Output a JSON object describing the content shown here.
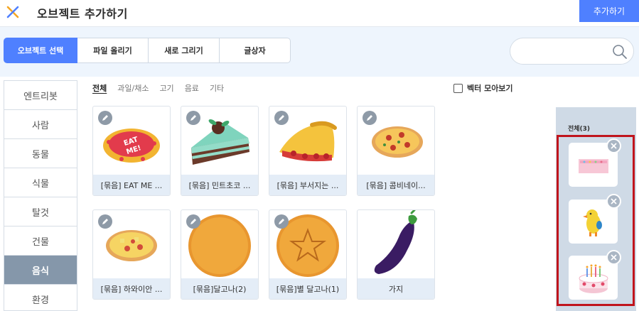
{
  "header": {
    "title": "오브젝트 추가하기",
    "add_button": "추가하기",
    "close_icon": "close-x-icon",
    "colors": {
      "accent": "#4f80ff",
      "close_x": [
        "#f5a623",
        "#4f80ff"
      ]
    }
  },
  "tabs": [
    {
      "label": "오브젝트 선택",
      "active": true
    },
    {
      "label": "파일 올리기",
      "active": false
    },
    {
      "label": "새로 그리기",
      "active": false
    },
    {
      "label": "글상자",
      "active": false
    }
  ],
  "search": {
    "placeholder": "",
    "icon": "search-icon"
  },
  "sidebar": {
    "items": [
      {
        "label": "엔트리봇",
        "active": false
      },
      {
        "label": "사람",
        "active": false
      },
      {
        "label": "동물",
        "active": false
      },
      {
        "label": "식물",
        "active": false
      },
      {
        "label": "탈것",
        "active": false
      },
      {
        "label": "건물",
        "active": false
      },
      {
        "label": "음식",
        "active": true
      },
      {
        "label": "환경",
        "active": false
      }
    ]
  },
  "subcategories": [
    {
      "label": "전체",
      "active": true
    },
    {
      "label": "과일/채소",
      "active": false
    },
    {
      "label": "고기",
      "active": false
    },
    {
      "label": "음료",
      "active": false
    },
    {
      "label": "기타",
      "active": false
    }
  ],
  "vector_toggle": {
    "label": "벡터 모아보기",
    "checked": false
  },
  "objects": [
    {
      "label": "[묶음] EAT ME ...",
      "vector": true,
      "thumb": "eat-me-cookie"
    },
    {
      "label": "[묶음] 민트초코 ...",
      "vector": true,
      "thumb": "mint-choco-cake"
    },
    {
      "label": "[묶음] 부서지는 ...",
      "vector": true,
      "thumb": "crumbling-pie"
    },
    {
      "label": "[묶음] 콤비네이...",
      "vector": true,
      "thumb": "combination-pizza"
    },
    {
      "label": "[묶음] 하와이안 ...",
      "vector": true,
      "thumb": "hawaiian-pizza"
    },
    {
      "label": "[묶음]달고나(2)",
      "vector": true,
      "thumb": "dalgona-plain"
    },
    {
      "label": "[묶음]별 달고나(1)",
      "vector": true,
      "thumb": "dalgona-star"
    },
    {
      "label": "가지",
      "vector": false,
      "thumb": "eggplant"
    }
  ],
  "selected": {
    "title": "전체(3)",
    "items": [
      {
        "thumb": "pink-banner"
      },
      {
        "thumb": "chick-character"
      },
      {
        "thumb": "birthday-cake"
      }
    ],
    "highlight_color": "#c0141c"
  }
}
